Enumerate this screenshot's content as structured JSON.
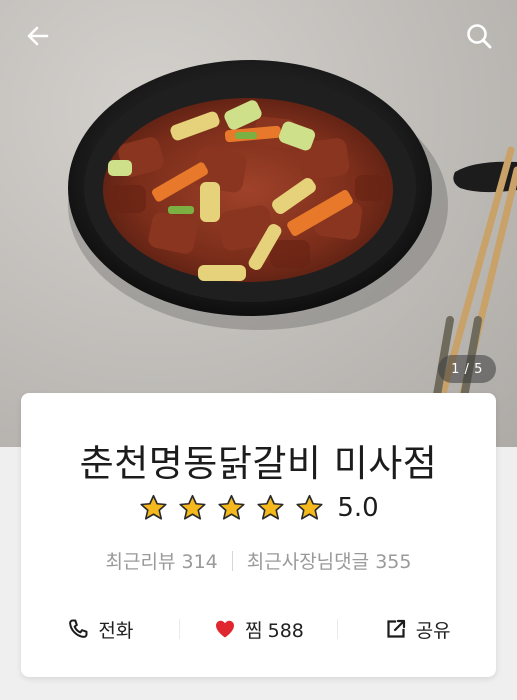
{
  "hero": {
    "photo_icon": "dakgalbi-photo",
    "back_icon": "arrow-left-icon",
    "search_icon": "search-icon",
    "counter": "1 / 5"
  },
  "restaurant": {
    "name": "춘천명동닭갈비 미사점",
    "rating": 5.0,
    "rating_text": "5.0",
    "stars_filled": 5,
    "stars_total": 5,
    "recent_reviews_label": "최근리뷰",
    "recent_reviews_count": "314",
    "owner_comments_label": "최근사장님댓글",
    "owner_comments_count": "355"
  },
  "actions": {
    "call_label": "전화",
    "call_icon": "phone-icon",
    "like_label": "찜",
    "like_count": "588",
    "like_icon": "heart-icon",
    "share_label": "공유",
    "share_icon": "share-icon"
  },
  "colors": {
    "star": "#F5B91E",
    "heart": "#E0262F",
    "text_primary": "#1C1C1C",
    "text_meta": "#9A9A9A"
  }
}
